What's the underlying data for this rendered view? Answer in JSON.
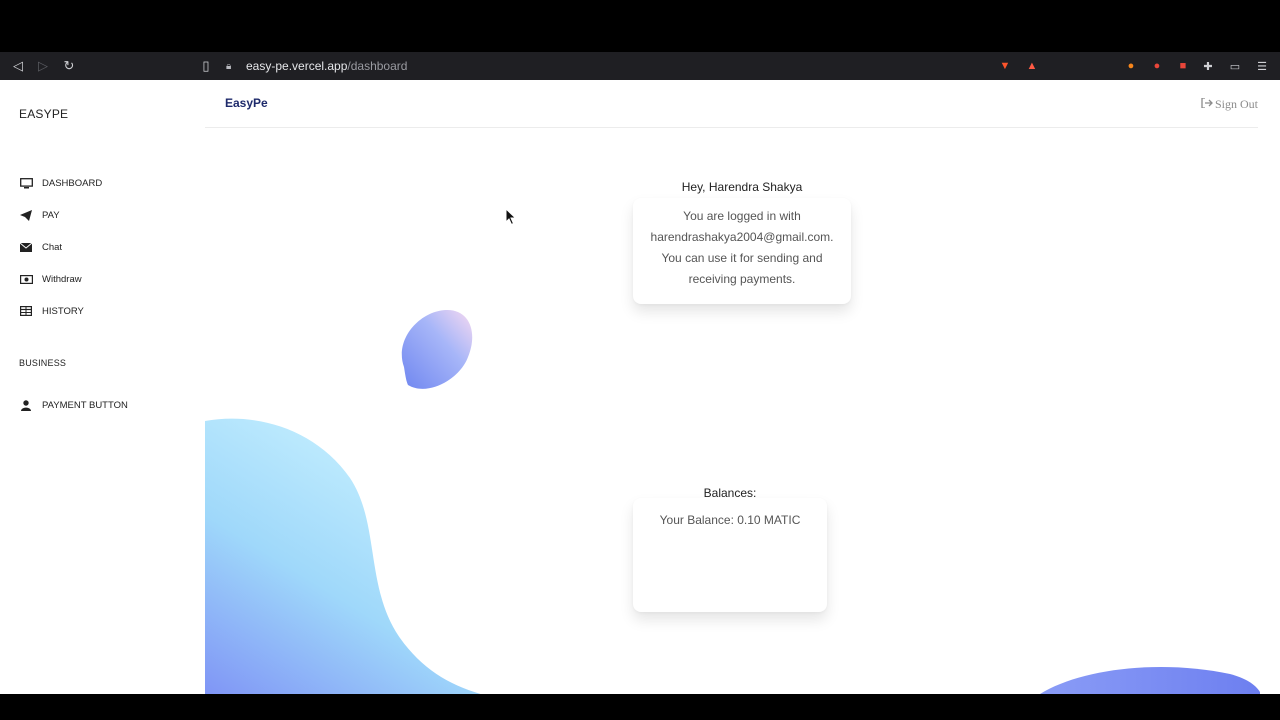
{
  "browser": {
    "url_host": "easy-pe.vercel.app",
    "url_path": "/dashboard"
  },
  "sidebar": {
    "brand": "EASYPE",
    "items": [
      {
        "label": "DASHBOARD",
        "icon": "monitor-icon"
      },
      {
        "label": "PAY",
        "icon": "paper-plane-icon"
      },
      {
        "label": "Chat",
        "icon": "envelope-icon"
      },
      {
        "label": "Withdraw",
        "icon": "money-icon"
      },
      {
        "label": "HISTORY",
        "icon": "table-icon"
      }
    ],
    "section_label": "BUSINESS",
    "business_items": [
      {
        "label": "PAYMENT BUTTON",
        "icon": "user-icon"
      }
    ]
  },
  "header": {
    "title": "EasyPe",
    "signout_label": "Sign Out"
  },
  "greeting_card": {
    "title": "Hey, Harendra Shakya",
    "line1": "You are logged in with",
    "email": "harendrashakya2004@gmail.com.",
    "line3": "You can use it for sending and",
    "line4": "receiving payments."
  },
  "balance_card": {
    "title": "Balances:",
    "balance_text": "Your Balance: 0.10 MATIC"
  },
  "colors": {
    "header_title": "#1e2a6b",
    "blob_start": "#7b8cf5",
    "blob_end": "#bfefff"
  }
}
